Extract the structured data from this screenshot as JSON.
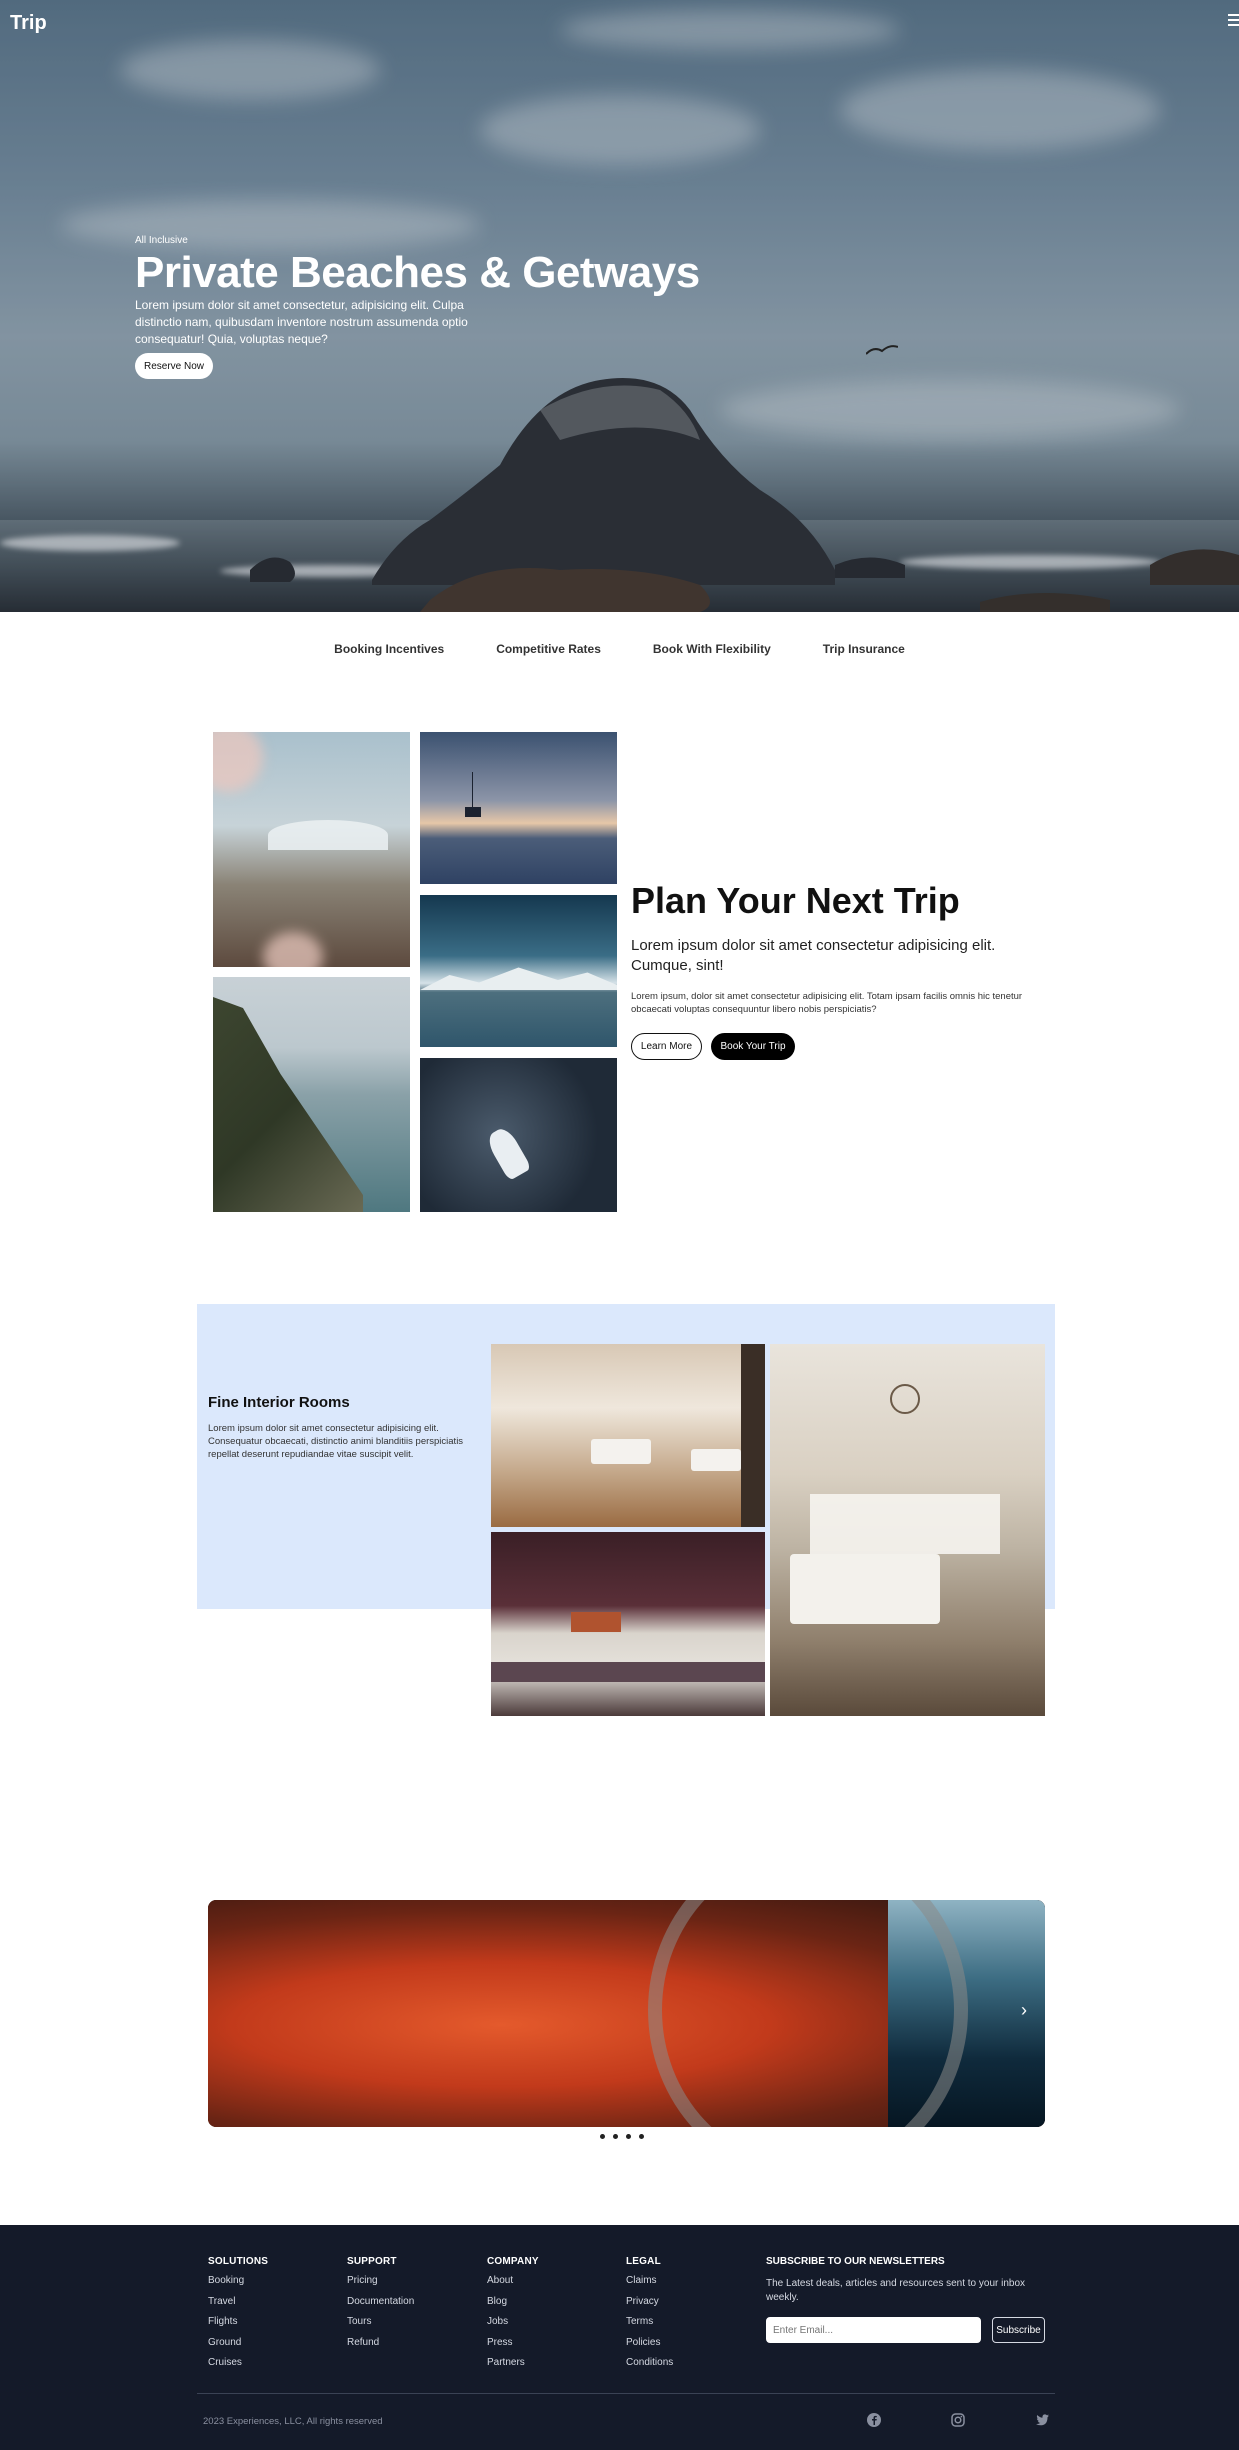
{
  "header": {
    "brand": "Trip",
    "menu_icon": "hamburger-menu-icon"
  },
  "hero": {
    "tag": "All Inclusive",
    "title": "Private Beaches & Getways",
    "description": "Lorem ipsum dolor sit amet consectetur, adipisicing elit. Culpa distinctio nam, quibusdam inventore nostrum assumenda optio consequatur! Quia, voluptas neque?",
    "button": "Reserve Now"
  },
  "features": [
    "Booking Incentives",
    "Competitive Rates",
    "Book With Flexibility",
    "Trip Insurance"
  ],
  "plan": {
    "title": "Plan Your Next Trip",
    "subtitle": "Lorem ipsum dolor sit amet consectetur adipisicing elit. Cumque, sint!",
    "body": "Lorem ipsum, dolor sit amet consectetur adipisicing elit. Totam ipsam facilis omnis hic tenetur obcaecati voluptas consequuntur libero nobis perspiciatis?",
    "learn_button": "Learn More",
    "book_button": "Book Your Trip"
  },
  "rooms": {
    "title": "Fine Interior Rooms",
    "body": "Lorem ipsum dolor sit amet consectetur adipisicing elit. Consequatur obcaecati, distinctio animi blanditiis perspiciatis repellat deserunt repudiandae vitae suscipit velit."
  },
  "carousel": {
    "next_icon": "chevron-right-icon",
    "next_label": "›",
    "dot_count": 4
  },
  "footer": {
    "columns": [
      {
        "title": "SOLUTIONS",
        "links": [
          "Booking",
          "Travel",
          "Flights",
          "Ground",
          "Cruises"
        ]
      },
      {
        "title": "SUPPORT",
        "links": [
          "Pricing",
          "Documentation",
          "Tours",
          "Refund"
        ]
      },
      {
        "title": "COMPANY",
        "links": [
          "About",
          "Blog",
          "Jobs",
          "Press",
          "Partners"
        ]
      },
      {
        "title": "LEGAL",
        "links": [
          "Claims",
          "Privacy",
          "Terms",
          "Policies",
          "Conditions"
        ]
      }
    ],
    "newsletter": {
      "title": "SUBSCRIBE TO OUR NEWSLETTERS",
      "text": "The Latest deals, articles and resources sent to your inbox weekly.",
      "placeholder": "Enter Email...",
      "button": "Subscribe"
    },
    "copyright": "2023 Experiences, LLC, All rights reserved",
    "social_icons": [
      "facebook-icon",
      "instagram-icon",
      "twitter-icon"
    ]
  }
}
